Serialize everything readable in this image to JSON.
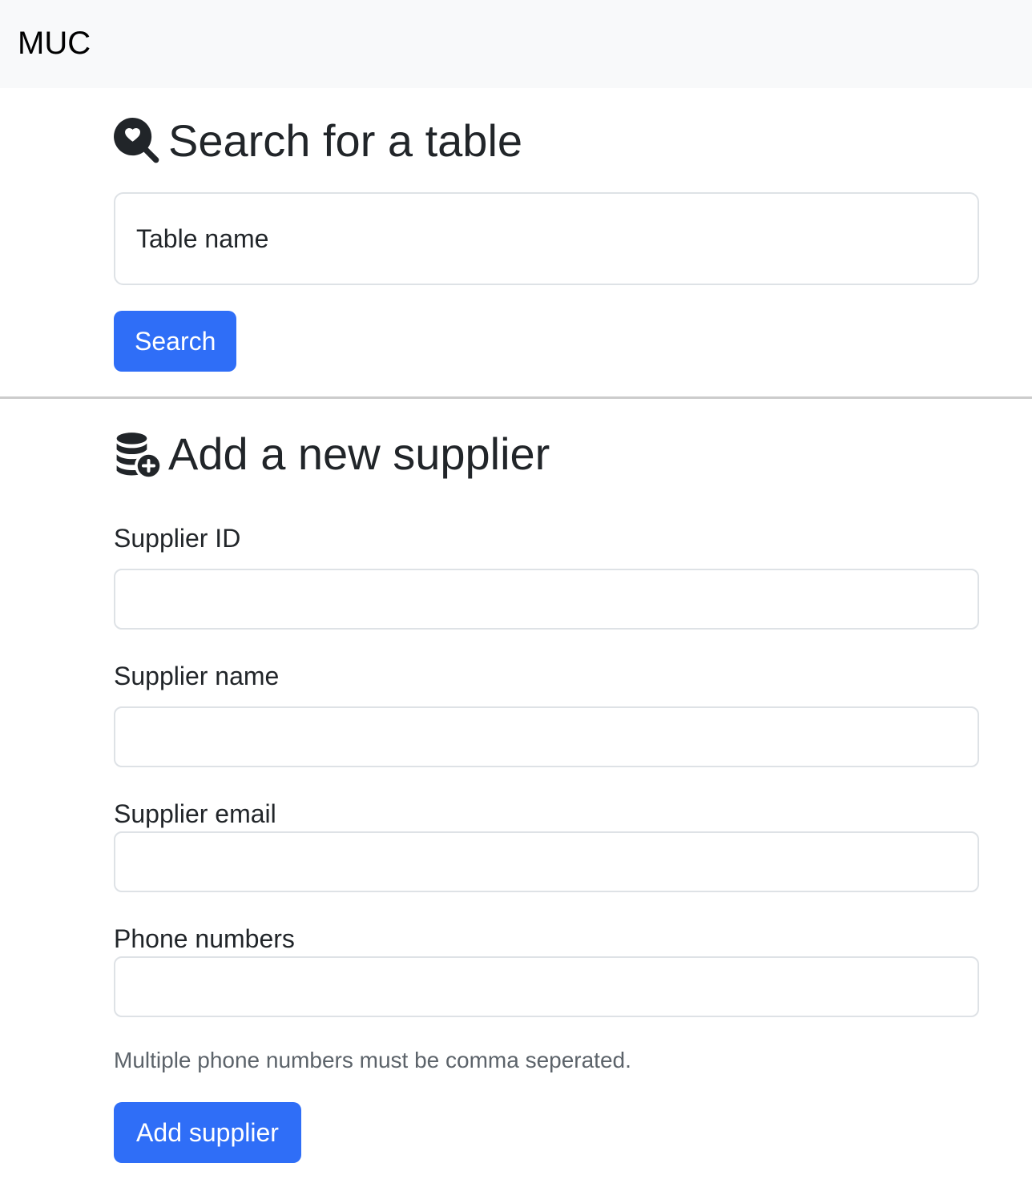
{
  "navbar": {
    "brand": "MUC"
  },
  "search_section": {
    "icon": "search-heart-icon",
    "title": "Search for a table",
    "input": {
      "placeholder": "Table name",
      "value": ""
    },
    "button_label": "Search"
  },
  "supplier_section": {
    "icon": "database-add-icon",
    "title": "Add a new supplier",
    "fields": {
      "supplier_id": {
        "label": "Supplier ID",
        "value": ""
      },
      "supplier_name": {
        "label": "Supplier name",
        "value": ""
      },
      "supplier_email": {
        "label": "Supplier email",
        "value": ""
      },
      "phone_numbers": {
        "label": "Phone numbers",
        "value": ""
      }
    },
    "help_text": "Multiple phone numbers must be comma seperated.",
    "button_label": "Add supplier"
  },
  "colors": {
    "primary": "#2f6ef7",
    "navbar_bg": "#f8f9fa",
    "text": "#212529",
    "muted": "#5c636a",
    "border": "#dee2e6",
    "divider": "#cccccc"
  }
}
